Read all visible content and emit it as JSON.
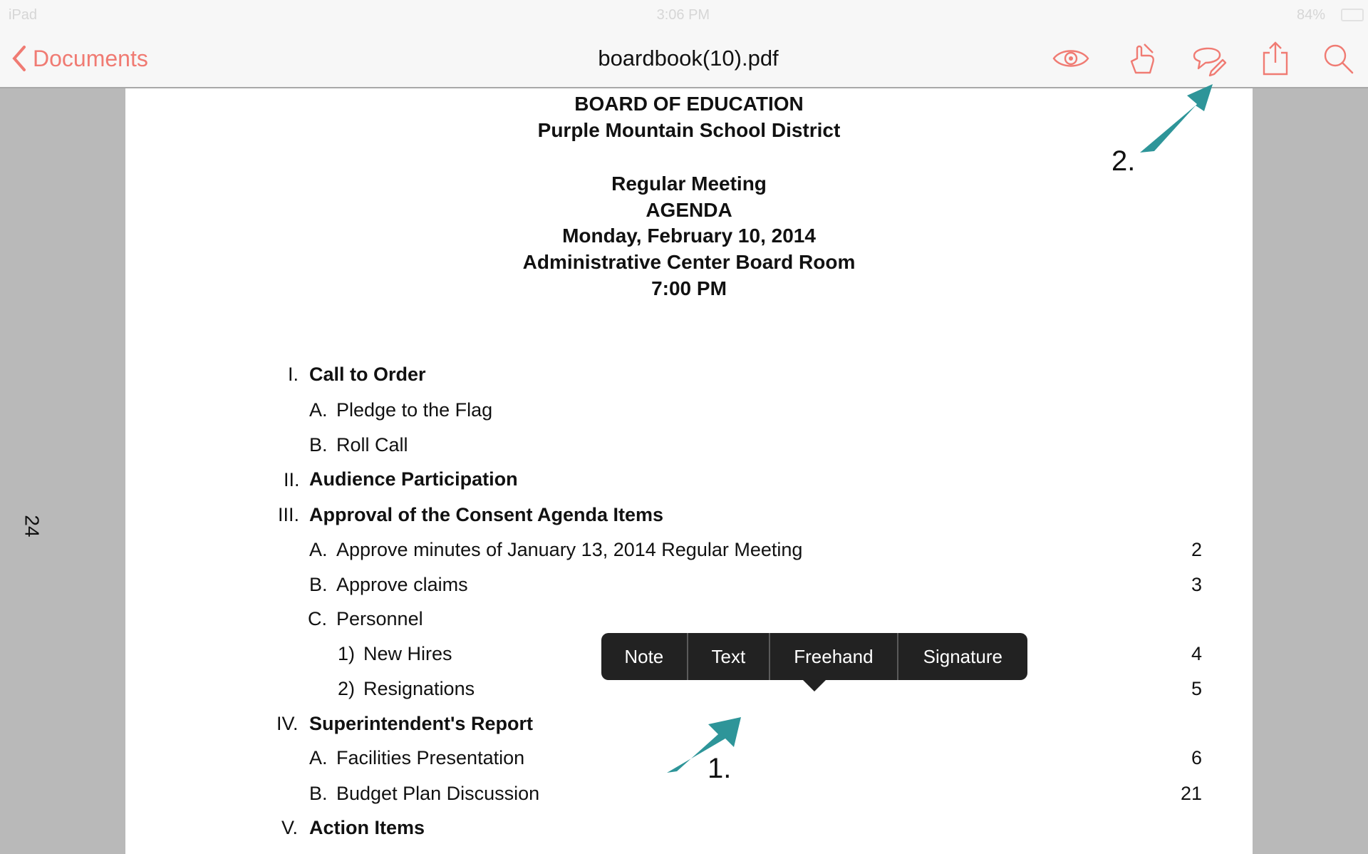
{
  "status_bar": {
    "device": "iPad",
    "time": "3:06 PM",
    "battery": "84%"
  },
  "toolbar": {
    "back_label": "Documents",
    "title": "boardbook(10).pdf",
    "icons": [
      "eye-icon",
      "hand-pen-icon",
      "comment-pencil-icon",
      "share-icon",
      "search-icon"
    ],
    "accent_color": "#f07b73"
  },
  "page_side_label": "24",
  "document": {
    "header": {
      "line1": "BOARD OF EDUCATION",
      "line2": "Purple Mountain School District",
      "line3": "Regular Meeting",
      "line4": "AGENDA",
      "line5": "Monday, February 10, 2014",
      "line6": "Administrative Center Board Room",
      "line7": "7:00 PM"
    },
    "items": [
      {
        "marker": "I.",
        "text": "Call to Order",
        "page": ""
      },
      {
        "marker": "A.",
        "text": "Pledge to the Flag",
        "page": ""
      },
      {
        "marker": "B.",
        "text": "Roll Call",
        "page": ""
      },
      {
        "marker": "II.",
        "text": "Audience Participation",
        "page": ""
      },
      {
        "marker": "III.",
        "text": "Approval of the Consent Agenda Items",
        "page": ""
      },
      {
        "marker": "A.",
        "text": "Approve minutes of January 13, 2014 Regular Meeting",
        "page": "2"
      },
      {
        "marker": "B.",
        "text": "Approve claims",
        "page": "3"
      },
      {
        "marker": "C.",
        "text": "Personnel",
        "page": ""
      },
      {
        "marker": "1)",
        "text": "New Hires",
        "page": "4"
      },
      {
        "marker": "2)",
        "text": "Resignations",
        "page": "5"
      },
      {
        "marker": "IV.",
        "text": "Superintendent's Report",
        "page": ""
      },
      {
        "marker": "A.",
        "text": "Facilities Presentation",
        "page": "6"
      },
      {
        "marker": "B.",
        "text": "Budget Plan Discussion",
        "page": "21"
      },
      {
        "marker": "V.",
        "text": "Action Items",
        "page": ""
      }
    ]
  },
  "annotation_menu": {
    "items": [
      "Note",
      "Text",
      "Freehand",
      "Signature"
    ]
  },
  "callouts": {
    "label1": "1.",
    "label2": "2.",
    "arrow_color": "#2e9599"
  }
}
